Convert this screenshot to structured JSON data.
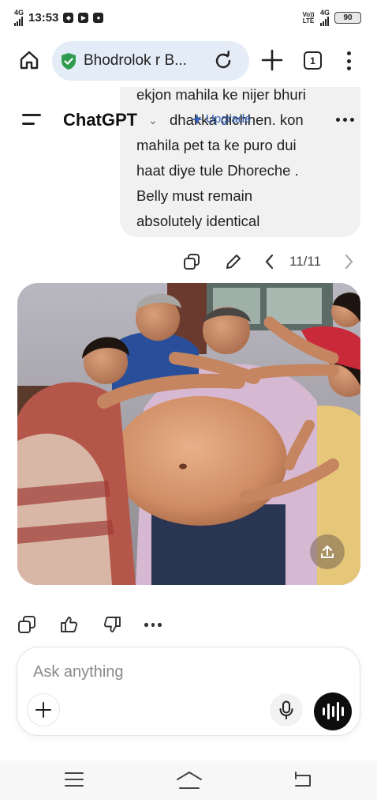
{
  "status_bar": {
    "network": "4G",
    "time": "13:53",
    "volte": "Vo)) LTE",
    "network_right": "4G",
    "battery": "90"
  },
  "browser": {
    "url_title": "Bhodrolok r B...",
    "tab_count": "1"
  },
  "chat": {
    "app_title": "ChatGPT",
    "upgrade_label": "Upgrade",
    "message_lines": [
      "ekjon mahila ke nijer bhuri",
      "dhakka dichhen. kon",
      "mahila pet  ta ke puro dui",
      "haat diye tule  Dhoreche .",
      "Belly must remain",
      "absolutely identical"
    ],
    "pager": "11/11"
  },
  "composer": {
    "placeholder": "Ask anything"
  },
  "icons": {
    "home": "home-icon",
    "shield": "shield-check-icon",
    "reload": "reload-icon",
    "new_tab": "plus-icon",
    "menu": "kebab-icon",
    "sidebar": "hamburger-icon",
    "copy": "copy-icon",
    "edit": "pencil-icon",
    "like": "thumbs-up-icon",
    "dislike": "thumbs-down-icon",
    "upload": "upload-icon",
    "mic": "mic-icon",
    "voice": "voice-waveform-icon"
  },
  "colors": {
    "url_pill": "#e4ecf7",
    "shield": "#2e9b4e",
    "upgrade": "#2f5db8",
    "bubble": "#f1f1f1",
    "voice_button": "#0d0d0d"
  }
}
